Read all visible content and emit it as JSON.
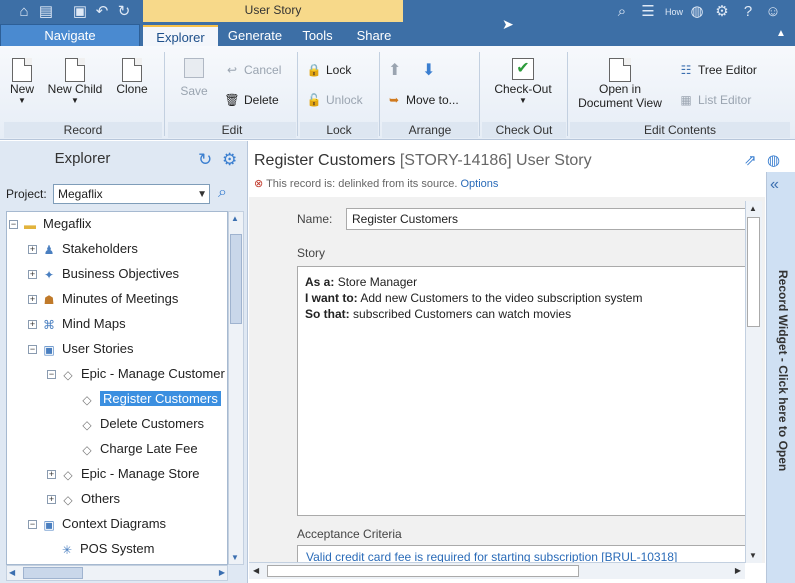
{
  "titlebar": {
    "context_tab": "User Story",
    "navigate": "Navigate",
    "tabs": [
      "Explorer",
      "Generate",
      "Tools",
      "Share"
    ],
    "how_label": "How"
  },
  "ribbon": {
    "record": {
      "label": "Record",
      "new": "New",
      "new_child": "New Child",
      "clone": "Clone"
    },
    "edit": {
      "label": "Edit",
      "save": "Save",
      "cancel": "Cancel",
      "delete": "Delete"
    },
    "lock": {
      "label": "Lock",
      "lock": "Lock",
      "unlock": "Unlock"
    },
    "arrange": {
      "label": "Arrange",
      "move_to": "Move to..."
    },
    "checkout": {
      "label": "Check Out",
      "check_out": "Check-Out"
    },
    "edit_contents": {
      "label": "Edit Contents",
      "open_doc_1": "Open in",
      "open_doc_2": "Document View",
      "tree_editor": "Tree Editor",
      "list_editor": "List Editor"
    }
  },
  "explorer": {
    "title": "Explorer",
    "project_label": "Project:",
    "project_value": "Megaflix",
    "tree": [
      {
        "label": "Megaflix"
      },
      {
        "label": "Stakeholders"
      },
      {
        "label": "Business Objectives"
      },
      {
        "label": "Minutes of Meetings"
      },
      {
        "label": "Mind Maps"
      },
      {
        "label": "User Stories"
      },
      {
        "label": "Epic - Manage Customer"
      },
      {
        "label": "Register Customers"
      },
      {
        "label": "Delete Customers"
      },
      {
        "label": "Charge Late Fee"
      },
      {
        "label": "Epic - Manage Store"
      },
      {
        "label": "Others"
      },
      {
        "label": "Context Diagrams"
      },
      {
        "label": "POS System"
      }
    ]
  },
  "record": {
    "title": "Register Customers",
    "id": "[STORY-14186] User Story",
    "delink_text": "This record is: delinked from its source.",
    "delink_options": "Options",
    "name_label": "Name:",
    "name_value": "Register Customers",
    "story_label": "Story",
    "story": {
      "as_a_label": "As a:",
      "as_a": "Store Manager",
      "i_want_label": "I want to:",
      "i_want": "Add new Customers to the video subscription system",
      "so_that_label": "So that:",
      "so_that": "subscribed Customers can watch movies"
    },
    "ac_label": "Acceptance Criteria",
    "ac_value": "Valid credit card fee is required for starting subscription [BRUL-10318]"
  },
  "widget": {
    "label": "Record Widget - Click here to Open"
  }
}
